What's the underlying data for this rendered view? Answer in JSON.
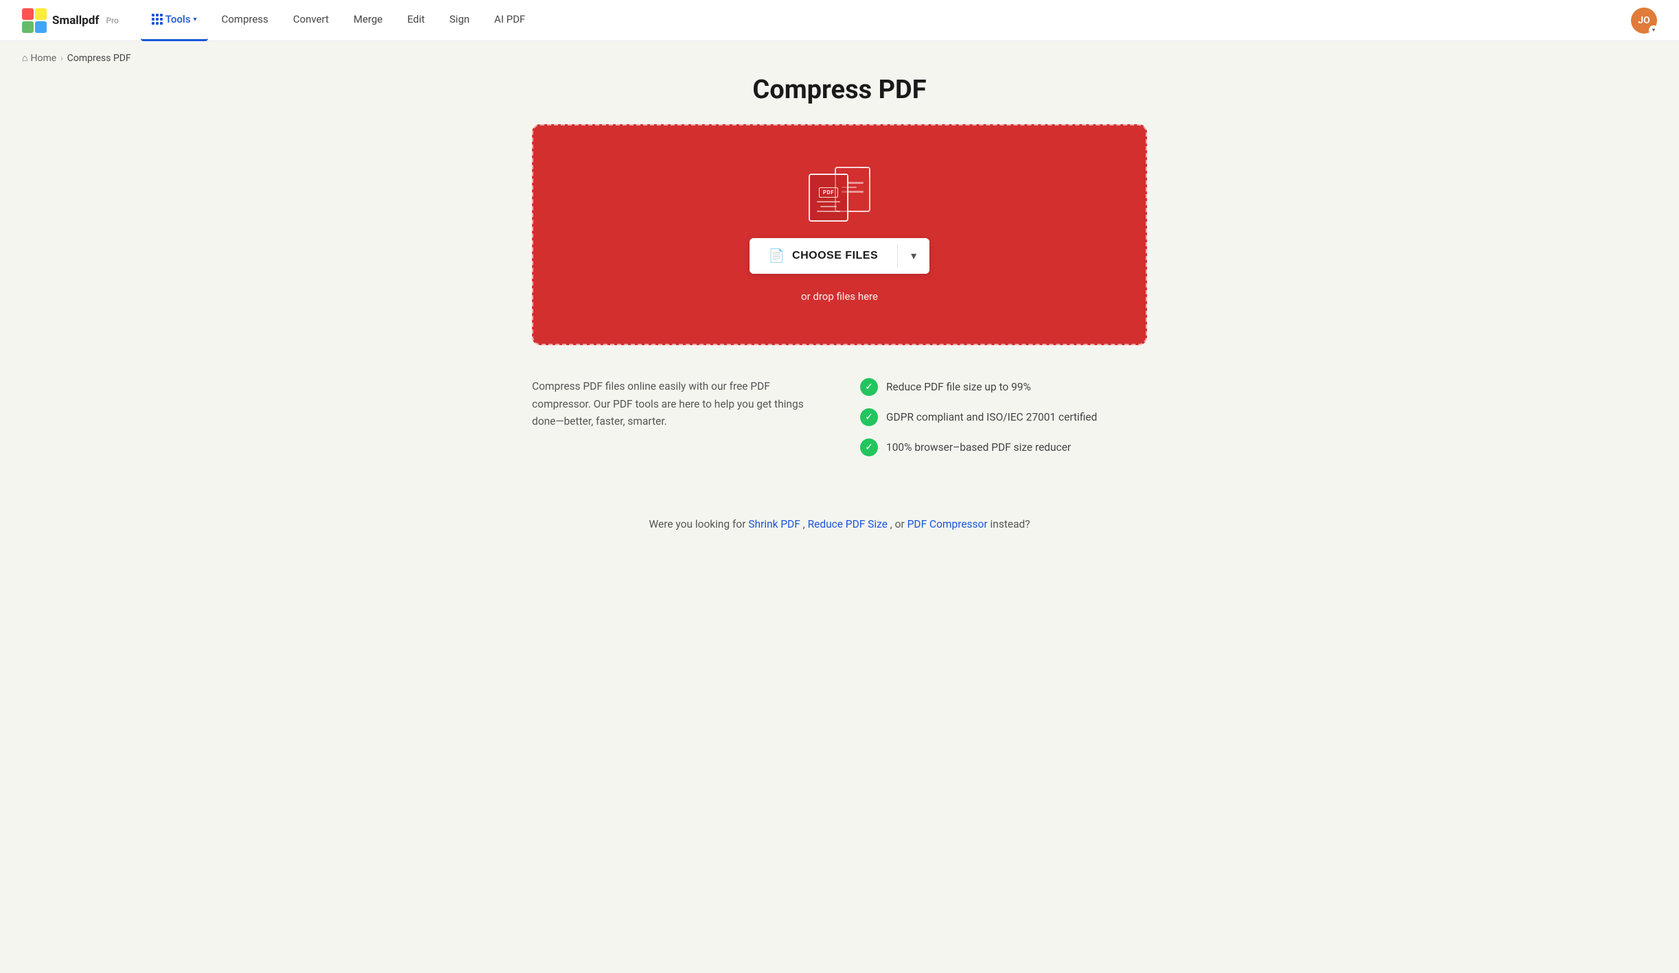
{
  "brand": {
    "logo_text": "Smallpdf",
    "logo_pro": "Pro",
    "user_initials": "JO"
  },
  "navbar": {
    "tools_label": "Tools",
    "compress_label": "Compress",
    "convert_label": "Convert",
    "merge_label": "Merge",
    "edit_label": "Edit",
    "sign_label": "Sign",
    "ai_pdf_label": "AI PDF"
  },
  "breadcrumb": {
    "home_label": "Home",
    "current_label": "Compress PDF"
  },
  "page": {
    "title": "Compress PDF",
    "drop_zone_hint": "or drop files here",
    "choose_files_label": "CHOOSE FILES"
  },
  "features": {
    "description": "Compress PDF files online easily with our free PDF compressor. Our PDF tools are here to help you get things done—better, faster, smarter.",
    "items": [
      {
        "text": "Reduce PDF file size up to 99%"
      },
      {
        "text": "GDPR compliant and ISO/IEC 27001 certified"
      },
      {
        "text": "100% browser–based PDF size reducer"
      }
    ]
  },
  "looking_for": {
    "prefix": "Were you looking for ",
    "link1_label": "Shrink PDF",
    "separator1": ", ",
    "link2_label": "Reduce PDF Size",
    "separator2": ", or ",
    "link3_label": "PDF Compressor",
    "suffix": " instead?"
  }
}
